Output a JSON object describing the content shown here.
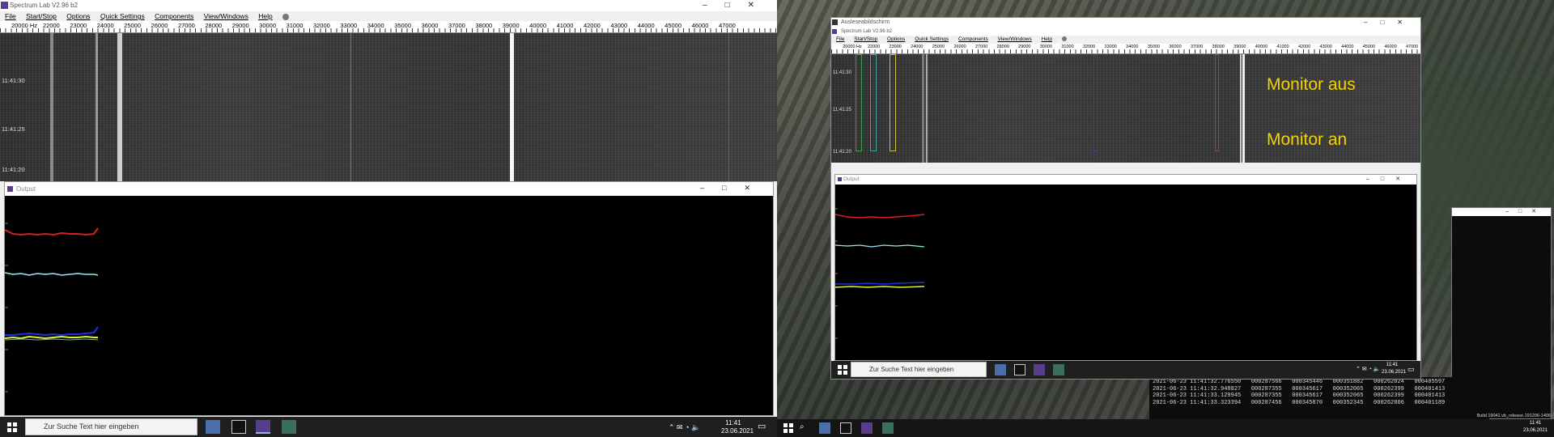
{
  "app": {
    "window_title": "Spectrum Lab V2.96 b2",
    "menu": [
      "File",
      "Start/Stop",
      "Options",
      "Quick Settings",
      "Components",
      "View/Windows",
      "Help"
    ]
  },
  "frequency_axis": {
    "labels": [
      "20000 Hz",
      "22000",
      "23000",
      "24000",
      "25000",
      "26000",
      "27000",
      "28000",
      "29000",
      "30000",
      "31000",
      "32000",
      "33000",
      "34000",
      "35000",
      "36000",
      "37000",
      "38000",
      "39000",
      "40000",
      "41000",
      "42000",
      "43000",
      "44000",
      "45000",
      "46000",
      "47000"
    ]
  },
  "waterfall": {
    "timestamps": [
      "11:41:30",
      "11:41:25",
      "11:41:20"
    ]
  },
  "output_window": {
    "title": "Output"
  },
  "remote_window": {
    "title": "Ausleseabildschirm"
  },
  "annotations": {
    "monitor_off": "Monitor aus",
    "monitor_on": "Monitor an"
  },
  "taskbar": {
    "search_placeholder": "Zur Suche Text hier eingeben",
    "time": "11:41",
    "date": "23.06.2021"
  },
  "console": {
    "lines": [
      "2021-06-23 11:41:32.776550   000287566   000345446   000351882   000262024   000405597",
      "2021-06-23 11:41:32.948827   000287355   000345617   000352065   000262399   000401413",
      "2021-06-23 11:41:33.129945   000287355   000345617   000352065   000262399   000401413",
      "2021-06-23 11:41:33.323394   000287456   000345870   000352345   000262806   000401189"
    ]
  },
  "build_info": "Build 19041.vb_release.191206-1406",
  "colors": {
    "red_trace": "#d42020",
    "cyan_trace": "#9ce8f0",
    "blue_trace": "#2030e0",
    "yellow_trace": "#d8f040",
    "annotation": "#f2d200"
  }
}
